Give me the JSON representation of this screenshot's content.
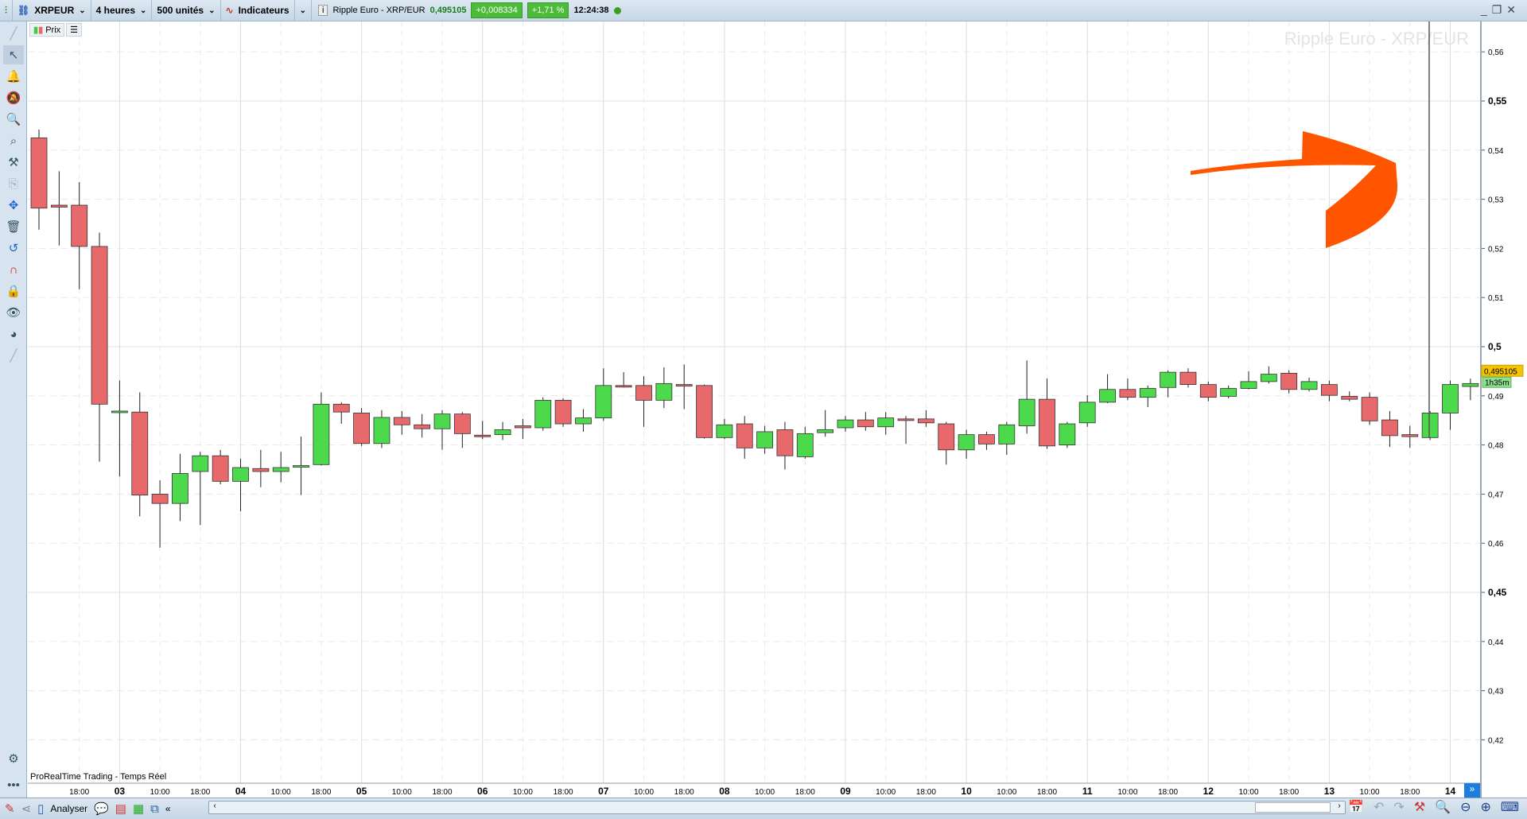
{
  "topbar": {
    "symbol": "XRPEUR",
    "timeframe": "4 heures",
    "units": "500 unités",
    "indicators": "Indicateurs",
    "instrument": "Ripple Euro - XRP/EUR",
    "price": "0,495105",
    "change": "+0,008334",
    "change_pct": "+1,71 %",
    "time": "12:24:38"
  },
  "chart_header": {
    "prix_label": "Prix"
  },
  "watermark": "Ripple Euro - XRP/EUR",
  "footer_label": "ProRealTime Trading - Temps Réel",
  "price_tag": "0,495105",
  "countdown_tag": "1h35m",
  "bottombar": {
    "analyser": "Analyser"
  },
  "colors": {
    "up": "#4cd94c",
    "down": "#e8696b",
    "arrow": "#ff5500",
    "price_tag": "#f5c400"
  },
  "chart_data": {
    "type": "candlestick",
    "ylim": [
      0.41,
      0.565
    ],
    "y_ticks": [
      "0,42",
      "0,43",
      "0,44",
      "0,45",
      "0,46",
      "0,47",
      "0,48",
      "0,49",
      "0,5",
      "0,51",
      "0,52",
      "0,53",
      "0,54",
      "0,55",
      "0,56"
    ],
    "y_tick_values": [
      0.42,
      0.43,
      0.44,
      0.45,
      0.46,
      0.47,
      0.48,
      0.49,
      0.5,
      0.51,
      0.52,
      0.53,
      0.54,
      0.55,
      0.56
    ],
    "x_ticks": [
      {
        "i": 2,
        "label": "18:00"
      },
      {
        "i": 4,
        "label": "03",
        "day": true
      },
      {
        "i": 6,
        "label": "10:00"
      },
      {
        "i": 8,
        "label": "18:00"
      },
      {
        "i": 10,
        "label": "04",
        "day": true
      },
      {
        "i": 12,
        "label": "10:00"
      },
      {
        "i": 14,
        "label": "18:00"
      },
      {
        "i": 16,
        "label": "05",
        "day": true
      },
      {
        "i": 18,
        "label": "10:00"
      },
      {
        "i": 20,
        "label": "18:00"
      },
      {
        "i": 22,
        "label": "06",
        "day": true
      },
      {
        "i": 24,
        "label": "10:00"
      },
      {
        "i": 26,
        "label": "18:00"
      },
      {
        "i": 28,
        "label": "07",
        "day": true
      },
      {
        "i": 30,
        "label": "10:00"
      },
      {
        "i": 32,
        "label": "18:00"
      },
      {
        "i": 34,
        "label": "08",
        "day": true
      },
      {
        "i": 36,
        "label": "10:00"
      },
      {
        "i": 38,
        "label": "18:00"
      },
      {
        "i": 40,
        "label": "09",
        "day": true
      },
      {
        "i": 42,
        "label": "10:00"
      },
      {
        "i": 44,
        "label": "18:00"
      },
      {
        "i": 46,
        "label": "10",
        "day": true
      },
      {
        "i": 48,
        "label": "10:00"
      },
      {
        "i": 50,
        "label": "18:00"
      },
      {
        "i": 52,
        "label": "11",
        "day": true
      },
      {
        "i": 54,
        "label": "10:00"
      },
      {
        "i": 56,
        "label": "18:00"
      },
      {
        "i": 58,
        "label": "12",
        "day": true
      },
      {
        "i": 60,
        "label": "10:00"
      },
      {
        "i": 62,
        "label": "18:00"
      },
      {
        "i": 64,
        "label": "13",
        "day": true
      },
      {
        "i": 66,
        "label": "10:00"
      },
      {
        "i": 68,
        "label": "18:00"
      },
      {
        "i": 70,
        "label": "14",
        "day": true
      }
    ],
    "ohlc": [
      [
        0.5425,
        0.5442,
        0.5238,
        0.5282
      ],
      [
        0.5288,
        0.5357,
        0.5206,
        0.5284
      ],
      [
        0.5288,
        0.5335,
        0.5117,
        0.5204
      ],
      [
        0.5204,
        0.5232,
        0.4766,
        0.4883
      ],
      [
        0.4869,
        0.4931,
        0.4736,
        0.4869
      ],
      [
        0.4867,
        0.4907,
        0.4655,
        0.4698
      ],
      [
        0.47,
        0.4728,
        0.4591,
        0.4681
      ],
      [
        0.4681,
        0.4782,
        0.4645,
        0.4742
      ],
      [
        0.4746,
        0.4786,
        0.4637,
        0.4778
      ],
      [
        0.4778,
        0.479,
        0.472,
        0.4726
      ],
      [
        0.4726,
        0.4772,
        0.4665,
        0.4754
      ],
      [
        0.4752,
        0.479,
        0.4714,
        0.4746
      ],
      [
        0.4746,
        0.4786,
        0.4724,
        0.4754
      ],
      [
        0.4758,
        0.4817,
        0.4698,
        0.4758
      ],
      [
        0.476,
        0.4907,
        0.4758,
        0.4883
      ],
      [
        0.4883,
        0.4887,
        0.4843,
        0.4867
      ],
      [
        0.4865,
        0.4875,
        0.4798,
        0.4803
      ],
      [
        0.4803,
        0.4871,
        0.4794,
        0.4856
      ],
      [
        0.4856,
        0.4869,
        0.4821,
        0.4841
      ],
      [
        0.4841,
        0.4863,
        0.4815,
        0.4833
      ],
      [
        0.4833,
        0.4871,
        0.479,
        0.4863
      ],
      [
        0.4863,
        0.4867,
        0.4794,
        0.4823
      ],
      [
        0.482,
        0.4849,
        0.4812,
        0.4819
      ],
      [
        0.4821,
        0.4847,
        0.481,
        0.4831
      ],
      [
        0.4839,
        0.4853,
        0.4812,
        0.4835
      ],
      [
        0.4835,
        0.4897,
        0.4829,
        0.4891
      ],
      [
        0.4891,
        0.4895,
        0.4837,
        0.4843
      ],
      [
        0.4843,
        0.4873,
        0.4827,
        0.4855
      ],
      [
        0.4855,
        0.4956,
        0.4849,
        0.4921
      ],
      [
        0.4921,
        0.4948,
        0.4917,
        0.4919
      ],
      [
        0.4921,
        0.494,
        0.4837,
        0.4891
      ],
      [
        0.4891,
        0.4958,
        0.4875,
        0.4925
      ],
      [
        0.4923,
        0.4964,
        0.4873,
        0.4921
      ],
      [
        0.4921,
        0.4923,
        0.4813,
        0.4815
      ],
      [
        0.4815,
        0.4853,
        0.4812,
        0.4841
      ],
      [
        0.4843,
        0.4859,
        0.4772,
        0.4794
      ],
      [
        0.4794,
        0.4839,
        0.4782,
        0.4827
      ],
      [
        0.4831,
        0.4847,
        0.475,
        0.4778
      ],
      [
        0.4776,
        0.4837,
        0.4772,
        0.4823
      ],
      [
        0.4825,
        0.4871,
        0.4817,
        0.4831
      ],
      [
        0.4835,
        0.4859,
        0.4827,
        0.4851
      ],
      [
        0.4851,
        0.4867,
        0.4829,
        0.4837
      ],
      [
        0.4837,
        0.4867,
        0.4821,
        0.4855
      ],
      [
        0.4853,
        0.4859,
        0.4802,
        0.4851
      ],
      [
        0.4853,
        0.4871,
        0.4837,
        0.4845
      ],
      [
        0.4843,
        0.4847,
        0.476,
        0.479
      ],
      [
        0.479,
        0.4831,
        0.4772,
        0.4821
      ],
      [
        0.4821,
        0.4827,
        0.479,
        0.4802
      ],
      [
        0.4802,
        0.4847,
        0.478,
        0.4841
      ],
      [
        0.4839,
        0.4972,
        0.4823,
        0.4893
      ],
      [
        0.4893,
        0.4935,
        0.4792,
        0.4798
      ],
      [
        0.48,
        0.4847,
        0.4794,
        0.4843
      ],
      [
        0.4845,
        0.4901,
        0.4837,
        0.4887
      ],
      [
        0.4887,
        0.4944,
        0.4885,
        0.4913
      ],
      [
        0.4913,
        0.4935,
        0.4891,
        0.4897
      ],
      [
        0.4897,
        0.4921,
        0.4877,
        0.4915
      ],
      [
        0.4917,
        0.4952,
        0.4897,
        0.4948
      ],
      [
        0.4948,
        0.4956,
        0.4917,
        0.4923
      ],
      [
        0.4923,
        0.4929,
        0.4889,
        0.4897
      ],
      [
        0.4899,
        0.4921,
        0.4895,
        0.4915
      ],
      [
        0.4915,
        0.495,
        0.4913,
        0.4929
      ],
      [
        0.4929,
        0.496,
        0.4925,
        0.4944
      ],
      [
        0.4946,
        0.4952,
        0.4905,
        0.4913
      ],
      [
        0.4913,
        0.4937,
        0.4909,
        0.4929
      ],
      [
        0.4923,
        0.4931,
        0.4889,
        0.4901
      ],
      [
        0.4899,
        0.4909,
        0.4889,
        0.4893
      ],
      [
        0.4897,
        0.4907,
        0.4841,
        0.4849
      ],
      [
        0.4851,
        0.4869,
        0.4796,
        0.4819
      ],
      [
        0.4821,
        0.4839,
        0.4794,
        0.4817
      ],
      [
        0.4815,
        0.4869,
        0.481,
        0.4865
      ],
      [
        0.4865,
        0.4931,
        0.4831,
        0.4923
      ],
      [
        0.4919,
        0.4935,
        0.4891,
        0.4925
      ]
    ]
  }
}
